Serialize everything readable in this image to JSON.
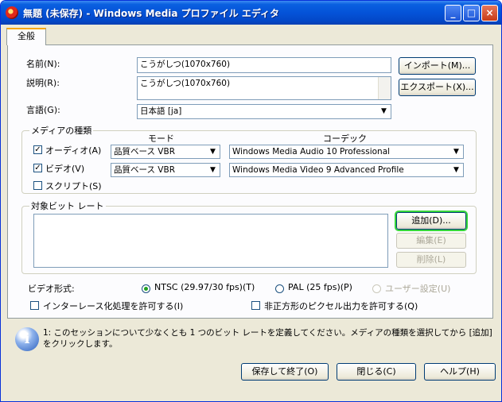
{
  "window": {
    "title": "無題 (未保存) - Windows Media プロファイル エディタ",
    "minimize": "_",
    "maximize": "□",
    "close": "×"
  },
  "tabs": [
    {
      "label": "全般"
    }
  ],
  "general": {
    "name_label": "名前(N):",
    "name_value": "こうがしつ(1070x760)",
    "description_label": "説明(R):",
    "description_value": "こうがしつ(1070x760)",
    "language_label": "言語(G):",
    "language_value": "日本語 [ja]",
    "import_button": "インポート(M)...",
    "export_button": "エクスポート(X)..."
  },
  "media_types": {
    "group_title": "メディアの種類",
    "mode_header": "モード",
    "codec_header": "コーデック",
    "rows": [
      {
        "label": "オーディオ(A)",
        "checked": true,
        "mode": "品質ベース VBR",
        "codec": "Windows Media Audio 10 Professional"
      },
      {
        "label": "ビデオ(V)",
        "checked": true,
        "mode": "品質ベース VBR",
        "codec": "Windows Media Video 9 Advanced Profile"
      },
      {
        "label": "スクリプト(S)",
        "checked": false
      }
    ]
  },
  "bitrates": {
    "group_title": "対象ビット レート",
    "add_button": "追加(D)...",
    "edit_button": "編集(E)",
    "delete_button": "削除(L)"
  },
  "video_format": {
    "label": "ビデオ形式:",
    "options": [
      {
        "label": "NTSC (29.97/30 fps)(T)",
        "selected": true,
        "enabled": true
      },
      {
        "label": "PAL (25 fps)(P)",
        "selected": false,
        "enabled": true
      },
      {
        "label": "ユーザー設定(U)",
        "selected": false,
        "enabled": false
      }
    ],
    "interlace_label": "インターレース化処理を許可する(I)",
    "nonsquare_label": "非正方形のピクセル出力を許可する(Q)"
  },
  "info": {
    "icon": "info-icon",
    "glyph": "i",
    "message": "1: このセッションについて少なくとも 1 つのビット レートを定義してください。メディアの種類を選択してから [追加] をクリックします。"
  },
  "footer": {
    "save_button": "保存して終了(O)",
    "close_button": "閉じる(C)",
    "help_button": "ヘルプ(H)"
  }
}
